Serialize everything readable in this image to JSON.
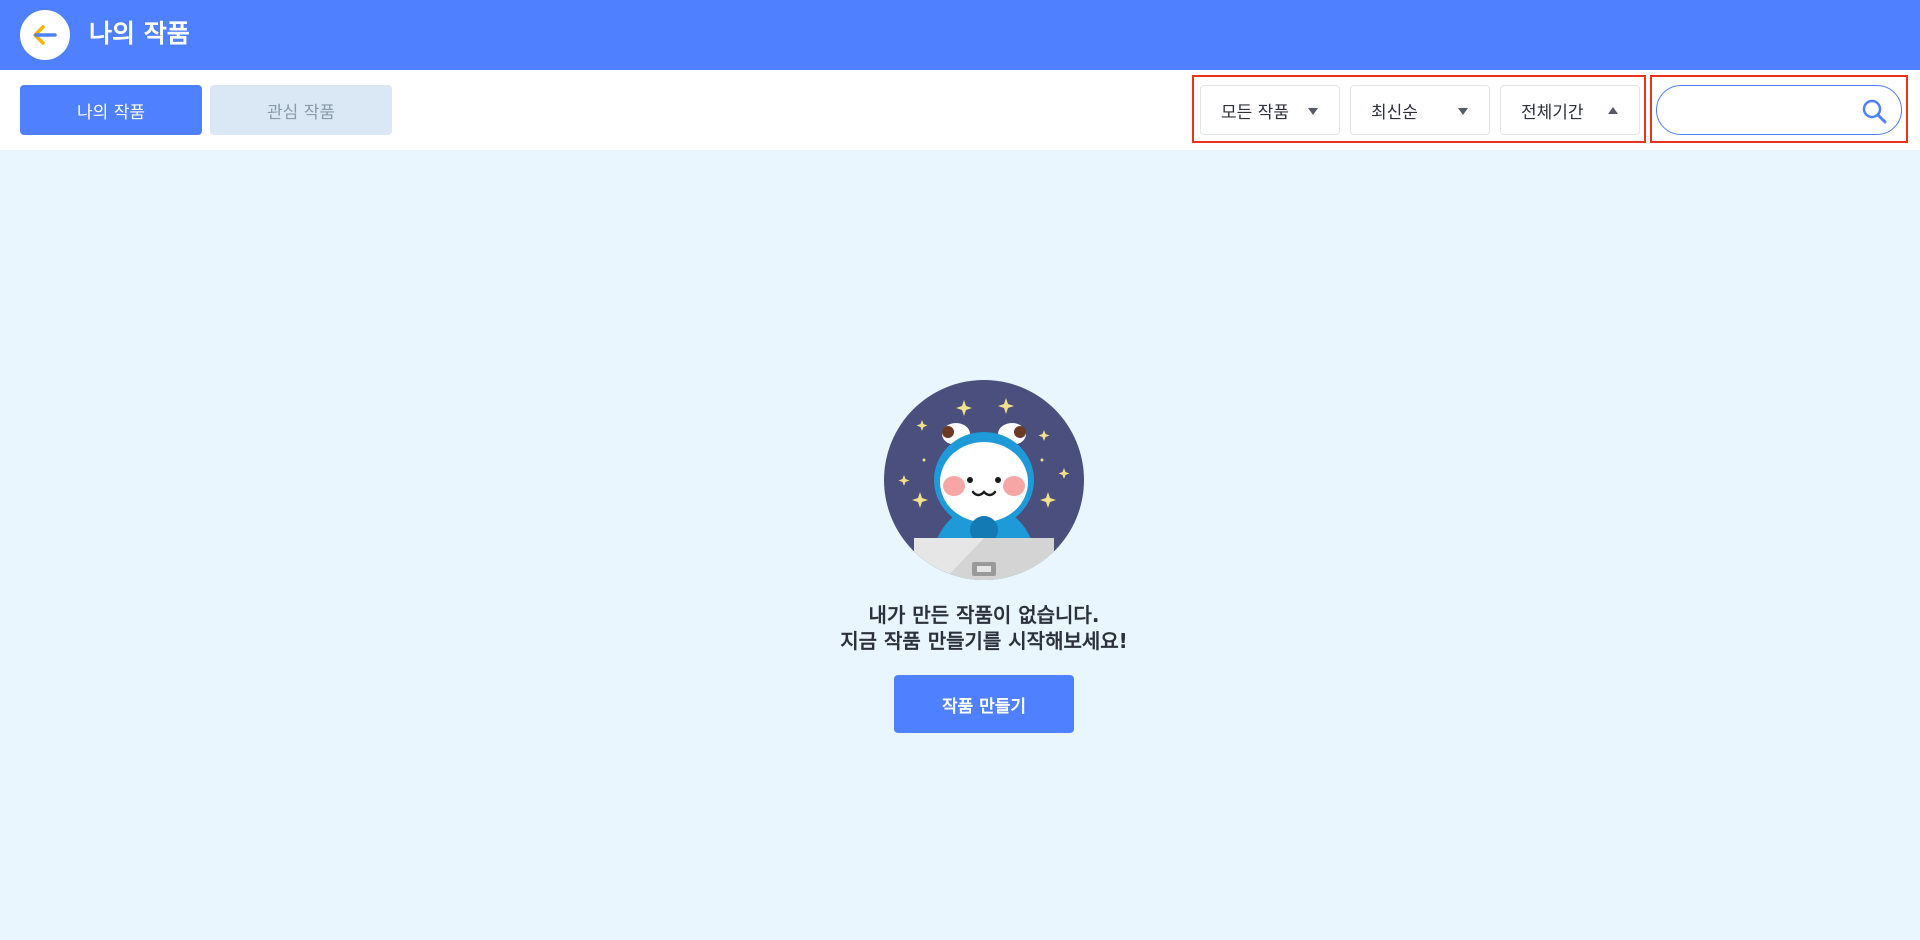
{
  "header": {
    "title": "나의 작품",
    "back_icon": "arrow-left-icon",
    "bg_color": "#4f80ff"
  },
  "tabs": [
    {
      "label": "나의 작품",
      "active": true
    },
    {
      "label": "관심 작품",
      "active": false
    }
  ],
  "filters": [
    {
      "selected": "모든 작품",
      "arrow": "down"
    },
    {
      "selected": "최신순",
      "arrow": "down"
    },
    {
      "selected": "전체기간",
      "arrow": "up"
    }
  ],
  "search": {
    "value": "",
    "placeholder": "",
    "icon": "search-icon"
  },
  "empty_state": {
    "line1": "내가 만든 작품이 없습니다.",
    "line2": "지금 작품 만들기를 시작해보세요!",
    "button_label": "작품 만들기"
  },
  "colors": {
    "accent": "#4f80ff",
    "highlight_border": "#e8341e",
    "main_bg": "#e9f6fd"
  }
}
